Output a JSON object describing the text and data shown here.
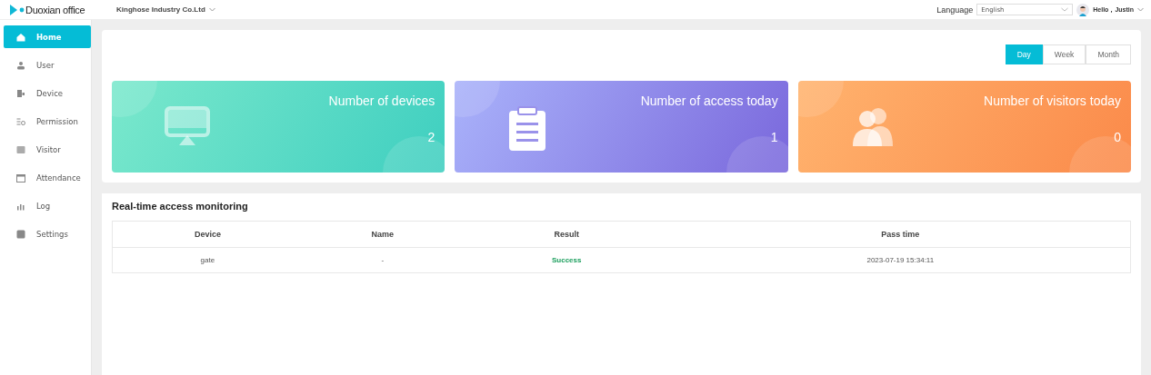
{
  "brand": {
    "name": "Duoxian office"
  },
  "company": {
    "name": "Kinghose Industry Co.Ltd"
  },
  "language": {
    "label": "Language",
    "value": "English"
  },
  "user": {
    "greeting": "Hello，Justin"
  },
  "sidebar": {
    "items": [
      {
        "label": "Home",
        "kind": "home",
        "selected": true
      },
      {
        "label": "User",
        "kind": "user",
        "selected": false
      },
      {
        "label": "Device",
        "kind": "device",
        "selected": false
      },
      {
        "label": "Permission",
        "kind": "permission",
        "selected": false
      },
      {
        "label": "Visitor",
        "kind": "visitor",
        "selected": false
      },
      {
        "label": "Attendance",
        "kind": "attendance",
        "selected": false
      },
      {
        "label": "Log",
        "kind": "log",
        "selected": false
      },
      {
        "label": "Settings",
        "kind": "settings",
        "selected": false
      }
    ]
  },
  "period_tabs": [
    {
      "label": "Day",
      "selected": true
    },
    {
      "label": "Week",
      "selected": false
    },
    {
      "label": "Month",
      "selected": false
    }
  ],
  "stat_cards": [
    {
      "kind": "devices",
      "title": "Number of devices",
      "value": "2"
    },
    {
      "kind": "access",
      "title": "Number of access today",
      "value": "1"
    },
    {
      "kind": "visitors",
      "title": "Number of visitors today",
      "value": "0"
    }
  ],
  "monitor": {
    "title": "Real-time access monitoring",
    "columns": [
      "Device",
      "Name",
      "Result",
      "Pass time"
    ],
    "rows": [
      {
        "device": "gate",
        "name": "-",
        "result": "Success",
        "time": "2023-07-19 15:34:11"
      }
    ]
  }
}
